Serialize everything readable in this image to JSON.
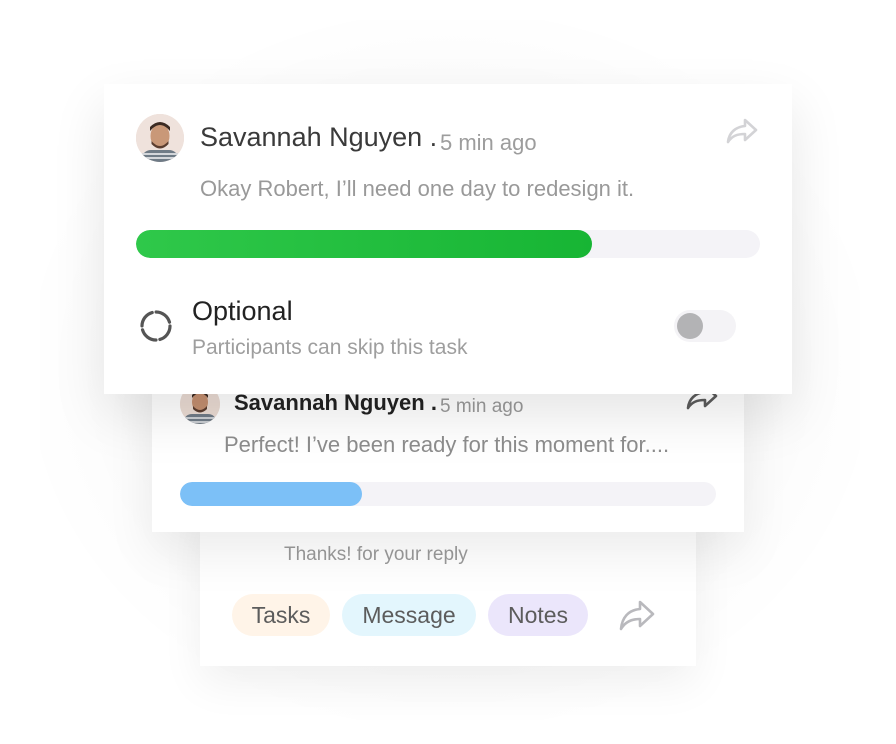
{
  "front_card": {
    "user_name": "Savannah Nguyen .",
    "time": "5 min ago",
    "message": "Okay Robert, I’ll need one day to redesign it.",
    "progress_fraction": 0.73,
    "progress_color": "#17b534",
    "option": {
      "title": "Optional",
      "subtitle": "Participants can skip this task",
      "toggle_on": false,
      "icon": "loading-spinner-icon"
    },
    "share_icon": "share-arrow-icon"
  },
  "middle_card": {
    "user_name": "Savannah Nguyen .",
    "time": "5 min ago",
    "message": "Perfect! I’ve been ready for this moment for....",
    "progress_fraction": 0.34,
    "progress_color": "#7cc0f7",
    "share_icon": "share-arrow-icon"
  },
  "back_card": {
    "message": "Thanks! for your reply",
    "chips": [
      {
        "label": "Tasks",
        "color": "#fff4e8"
      },
      {
        "label": "Message",
        "color": "#e3f6fd"
      },
      {
        "label": "Notes",
        "color": "#ebe6fb"
      }
    ],
    "share_icon": "share-arrow-icon"
  }
}
